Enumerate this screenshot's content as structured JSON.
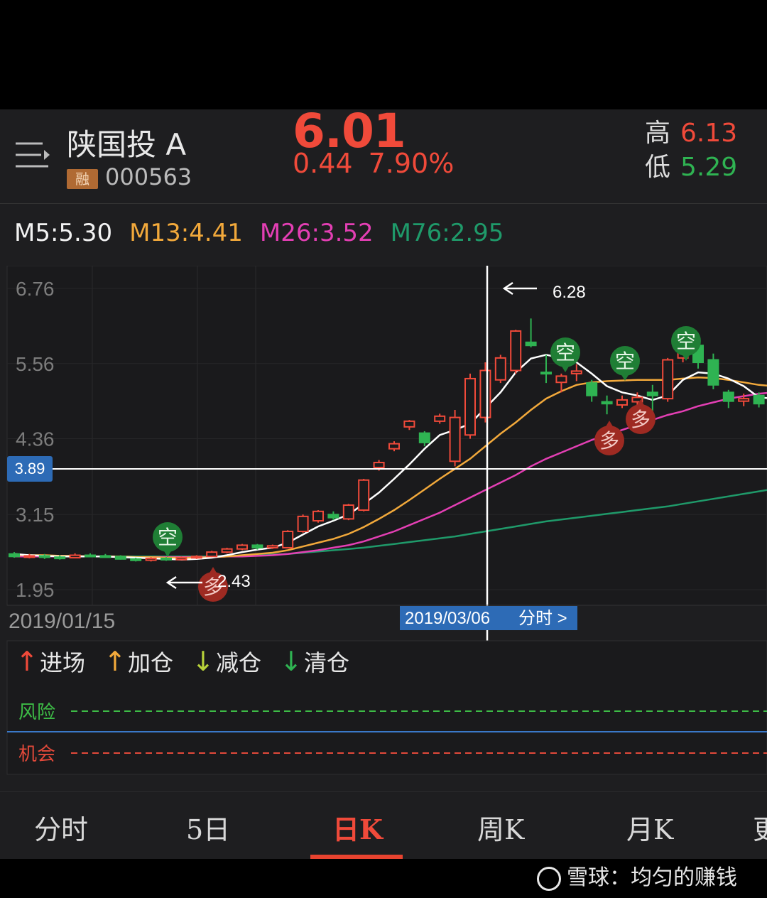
{
  "header": {
    "stock_name": "陕国投 A",
    "margin_badge": "融",
    "stock_code": "000563",
    "price": "6.01",
    "change_amount": "0.44",
    "change_percent": "7.90%",
    "high_label": "高",
    "high_value": "6.13",
    "low_label": "低",
    "low_value": "5.29"
  },
  "colors": {
    "up": "#f04a3a",
    "down": "#2fb352",
    "ma5": "#ffffff",
    "ma13": "#f2a93b",
    "ma26": "#e43fb4",
    "ma76": "#1f9a6a"
  },
  "ma_legend": [
    {
      "label": "M5:5.30"
    },
    {
      "label": "M13:4.41"
    },
    {
      "label": "M26:3.52"
    },
    {
      "label": "M76:2.95"
    }
  ],
  "chart": {
    "y_ticks": [
      "6.76",
      "5.56",
      "4.36",
      "3.15",
      "1.95"
    ],
    "crosshair_price": "3.89",
    "start_date": "2019/01/15",
    "crosshair_date": "2019/03/06",
    "intraday_link": "分时 >",
    "max_annotation": "6.28",
    "min_annotation": "2.43",
    "signal_short": "空",
    "signal_long": "多"
  },
  "indicator": {
    "legend": [
      {
        "arrow": "↑",
        "label": "进场",
        "color": "#f04a3a"
      },
      {
        "arrow": "↑",
        "label": "加仓",
        "color": "#f2a93b"
      },
      {
        "arrow": "↓",
        "label": "减仓",
        "color": "#b8d23a"
      },
      {
        "arrow": "↓",
        "label": "清仓",
        "color": "#2fb352"
      }
    ],
    "risk_label": "风险",
    "opportunity_label": "机会"
  },
  "tabs": [
    {
      "label": "分时"
    },
    {
      "label": "5日"
    },
    {
      "label": "日K"
    },
    {
      "label": "周K"
    },
    {
      "label": "月K"
    },
    {
      "label": "更"
    }
  ],
  "active_tab": "日K",
  "watermark": "雪球：均匀的赚钱",
  "chart_data": {
    "type": "candlestick",
    "start_date": "2019/01/15",
    "ylim": [
      1.95,
      6.76
    ],
    "y_ticks": [
      6.76,
      5.56,
      4.36,
      3.15,
      1.95
    ],
    "candles": [
      [
        2.52,
        2.48,
        2.55,
        2.46
      ],
      [
        2.48,
        2.49,
        2.52,
        2.45
      ],
      [
        2.49,
        2.47,
        2.52,
        2.44
      ],
      [
        2.47,
        2.46,
        2.5,
        2.43
      ],
      [
        2.46,
        2.5,
        2.53,
        2.45
      ],
      [
        2.5,
        2.49,
        2.53,
        2.47
      ],
      [
        2.49,
        2.48,
        2.52,
        2.46
      ],
      [
        2.48,
        2.44,
        2.5,
        2.43
      ],
      [
        2.44,
        2.42,
        2.46,
        2.4
      ],
      [
        2.42,
        2.45,
        2.47,
        2.4
      ],
      [
        2.45,
        2.43,
        2.47,
        2.41
      ],
      [
        2.43,
        2.46,
        2.48,
        2.42
      ],
      [
        2.46,
        2.48,
        2.5,
        2.44
      ],
      [
        2.48,
        2.55,
        2.57,
        2.47
      ],
      [
        2.55,
        2.6,
        2.62,
        2.53
      ],
      [
        2.6,
        2.66,
        2.68,
        2.58
      ],
      [
        2.66,
        2.62,
        2.68,
        2.59
      ],
      [
        2.62,
        2.65,
        2.67,
        2.6
      ],
      [
        2.62,
        2.88,
        2.9,
        2.62
      ],
      [
        2.88,
        3.12,
        3.15,
        2.86
      ],
      [
        3.05,
        3.2,
        3.22,
        3.02
      ],
      [
        3.15,
        3.1,
        3.2,
        3.06
      ],
      [
        3.08,
        3.3,
        3.32,
        3.06
      ],
      [
        3.22,
        3.7,
        3.72,
        3.2
      ],
      [
        3.9,
        3.98,
        4.02,
        3.85
      ],
      [
        4.2,
        4.28,
        4.32,
        4.16
      ],
      [
        4.55,
        4.64,
        4.66,
        4.5
      ],
      [
        4.45,
        4.3,
        4.48,
        4.24
      ],
      [
        4.64,
        4.72,
        4.76,
        4.6
      ],
      [
        4.0,
        4.7,
        4.82,
        3.92
      ],
      [
        4.42,
        5.32,
        5.4,
        4.36
      ],
      [
        4.7,
        5.45,
        5.58,
        4.62
      ],
      [
        5.3,
        5.65,
        5.7,
        5.25
      ],
      [
        5.45,
        6.08,
        6.1,
        5.4
      ],
      [
        5.9,
        5.85,
        6.28,
        5.82
      ],
      [
        5.42,
        5.4,
        5.7,
        5.25
      ],
      [
        5.26,
        5.36,
        5.4,
        5.1
      ],
      [
        5.4,
        5.44,
        5.55,
        5.28
      ],
      [
        5.25,
        5.05,
        5.3,
        4.95
      ],
      [
        4.95,
        4.92,
        5.05,
        4.75
      ],
      [
        4.9,
        4.98,
        5.05,
        4.85
      ],
      [
        4.95,
        5.02,
        5.1,
        4.9
      ],
      [
        5.1,
        5.05,
        5.22,
        4.78
      ],
      [
        5.0,
        5.62,
        5.65,
        4.95
      ],
      [
        5.65,
        5.85,
        6.13,
        5.58
      ],
      [
        5.85,
        5.58,
        5.9,
        5.48
      ],
      [
        5.62,
        5.22,
        5.72,
        5.15
      ],
      [
        5.1,
        4.96,
        5.14,
        4.85
      ],
      [
        4.96,
        5.0,
        5.08,
        4.88
      ],
      [
        5.05,
        4.92,
        5.1,
        4.86
      ],
      [
        4.8,
        5.1,
        5.18,
        4.76
      ],
      [
        5.05,
        5.3,
        5.38,
        5.0
      ]
    ],
    "series": [
      {
        "name": "M5",
        "values": [
          2.52,
          2.5,
          2.49,
          2.48,
          2.48,
          2.48,
          2.48,
          2.47,
          2.46,
          2.45,
          2.44,
          2.43,
          2.44,
          2.46,
          2.5,
          2.55,
          2.59,
          2.62,
          2.7,
          2.83,
          2.96,
          3.05,
          3.15,
          3.32,
          3.5,
          3.72,
          3.95,
          4.2,
          4.42,
          4.5,
          4.6,
          4.85,
          5.1,
          5.42,
          5.64,
          5.7,
          5.65,
          5.58,
          5.4,
          5.2,
          5.1,
          5.05,
          4.98,
          5.05,
          5.3,
          5.42,
          5.4,
          5.32,
          5.2,
          5.02,
          5.0,
          5.05
        ]
      },
      {
        "name": "M13",
        "values": [
          2.5,
          2.5,
          2.5,
          2.49,
          2.49,
          2.48,
          2.48,
          2.48,
          2.47,
          2.47,
          2.46,
          2.46,
          2.46,
          2.47,
          2.48,
          2.5,
          2.52,
          2.54,
          2.58,
          2.64,
          2.7,
          2.76,
          2.84,
          2.95,
          3.08,
          3.22,
          3.38,
          3.55,
          3.72,
          3.88,
          4.04,
          4.24,
          4.44,
          4.62,
          4.82,
          5.0,
          5.12,
          5.22,
          5.26,
          5.28,
          5.29,
          5.3,
          5.3,
          5.3,
          5.32,
          5.34,
          5.33,
          5.3,
          5.26,
          5.22,
          5.2,
          5.2
        ]
      },
      {
        "name": "M26",
        "values": [
          2.48,
          2.48,
          2.48,
          2.48,
          2.48,
          2.48,
          2.48,
          2.47,
          2.47,
          2.47,
          2.47,
          2.47,
          2.47,
          2.47,
          2.48,
          2.48,
          2.49,
          2.5,
          2.52,
          2.55,
          2.58,
          2.62,
          2.66,
          2.72,
          2.8,
          2.88,
          2.98,
          3.08,
          3.18,
          3.3,
          3.42,
          3.54,
          3.66,
          3.78,
          3.92,
          4.04,
          4.14,
          4.24,
          4.34,
          4.42,
          4.5,
          4.58,
          4.66,
          4.74,
          4.8,
          4.88,
          4.94,
          5.0,
          5.04,
          5.08,
          5.1,
          5.12
        ]
      },
      {
        "name": "M76",
        "values": [
          2.48,
          2.48,
          2.48,
          2.48,
          2.48,
          2.48,
          2.48,
          2.48,
          2.48,
          2.48,
          2.48,
          2.48,
          2.48,
          2.48,
          2.49,
          2.49,
          2.5,
          2.51,
          2.52,
          2.54,
          2.56,
          2.58,
          2.6,
          2.62,
          2.65,
          2.68,
          2.71,
          2.74,
          2.77,
          2.8,
          2.84,
          2.88,
          2.92,
          2.96,
          3.0,
          3.04,
          3.07,
          3.1,
          3.13,
          3.16,
          3.19,
          3.22,
          3.25,
          3.28,
          3.32,
          3.36,
          3.4,
          3.44,
          3.48,
          3.52,
          3.56,
          3.6
        ]
      }
    ]
  }
}
